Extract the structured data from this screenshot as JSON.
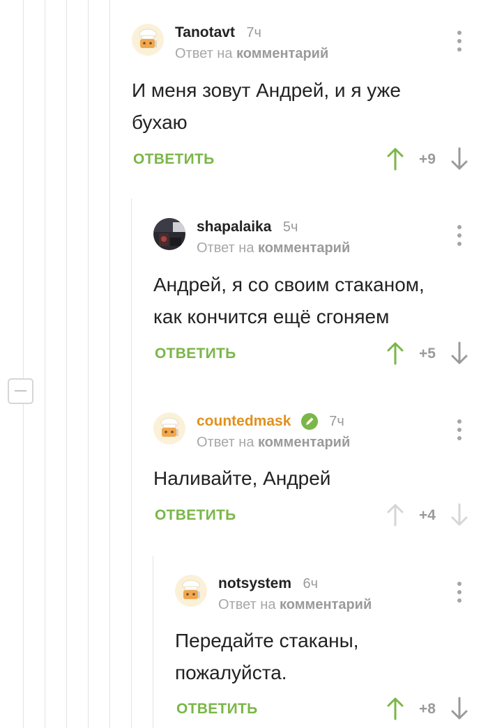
{
  "thread": {
    "collapse_label": "−"
  },
  "comments": [
    {
      "username": "Tanotavt",
      "time": "7ч",
      "reply_prefix": "Ответ на",
      "reply_target": "комментарий",
      "text": "И меня зовут Андрей, и я уже\nбухаю",
      "reply_label": "ОТВЕТИТЬ",
      "rating": "+9",
      "avatar": "cook-hat-avatar",
      "voted_up": true
    },
    {
      "username": "shapalaika",
      "time": "5ч",
      "reply_prefix": "Ответ на",
      "reply_target": "комментарий",
      "text": "Андрей, я со своим стаканом,\nкак кончится ещё сгоняем",
      "reply_label": "ОТВЕТИТЬ",
      "rating": "+5",
      "avatar": "photo-avatar",
      "voted_up": true
    },
    {
      "username": "countedmask",
      "time": "7ч",
      "reply_prefix": "Ответ на",
      "reply_target": "комментарий",
      "text": "Наливайте, Андрей",
      "reply_label": "ОТВЕТИТЬ",
      "rating": "+4",
      "avatar": "cook-hat-avatar",
      "verified_icon": "pencil-check-icon",
      "username_color": "#e0911d",
      "voted_up": false
    },
    {
      "username": "notsystem",
      "time": "6ч",
      "reply_prefix": "Ответ на",
      "reply_target": "комментарий",
      "text": "Передайте стаканы,\nпожалуйста.",
      "reply_label": "ОТВЕТИТЬ",
      "rating": "+8",
      "avatar": "cook-hat-avatar",
      "voted_up": true
    }
  ],
  "colors": {
    "accent_green": "#7ab648",
    "muted_gray": "#9a9a9a",
    "author_orange": "#e0911d",
    "thread_line": "#e3e3e3"
  }
}
